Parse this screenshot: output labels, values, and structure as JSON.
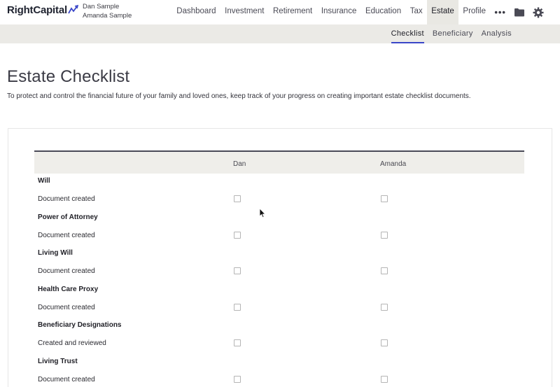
{
  "brand": {
    "name": "RightCapital"
  },
  "users": [
    "Dan Sample",
    "Amanda Sample"
  ],
  "nav": {
    "items": [
      "Dashboard",
      "Investment",
      "Retirement",
      "Insurance",
      "Education",
      "Tax",
      "Estate",
      "Profile"
    ],
    "active": "Estate",
    "more_icon": "ellipsis-icon",
    "folder_icon": "folder-icon",
    "settings_icon": "gear-icon"
  },
  "subnav": {
    "items": [
      "Checklist",
      "Beneficiary",
      "Analysis"
    ],
    "active": "Checklist"
  },
  "page": {
    "title": "Estate Checklist",
    "description": "To protect and control the financial future of your family and loved ones, keep track of your progress on creating important estate checklist documents."
  },
  "table": {
    "columns": [
      "Dan",
      "Amanda"
    ],
    "sections": [
      {
        "name": "Will",
        "item": "Document created",
        "checked": [
          false,
          false
        ]
      },
      {
        "name": "Power of Attorney",
        "item": "Document created",
        "checked": [
          false,
          false
        ]
      },
      {
        "name": "Living Will",
        "item": "Document created",
        "checked": [
          false,
          false
        ]
      },
      {
        "name": "Health Care Proxy",
        "item": "Document created",
        "checked": [
          false,
          false
        ]
      },
      {
        "name": "Beneficiary Designations",
        "item": "Created and reviewed",
        "checked": [
          false,
          false
        ]
      },
      {
        "name": "Living Trust",
        "item": "Document created",
        "checked": [
          false,
          false
        ]
      }
    ]
  },
  "colors": {
    "accent": "#3a46c8",
    "subbar": "#ebeae6",
    "header_rule": "#4a4a58"
  }
}
